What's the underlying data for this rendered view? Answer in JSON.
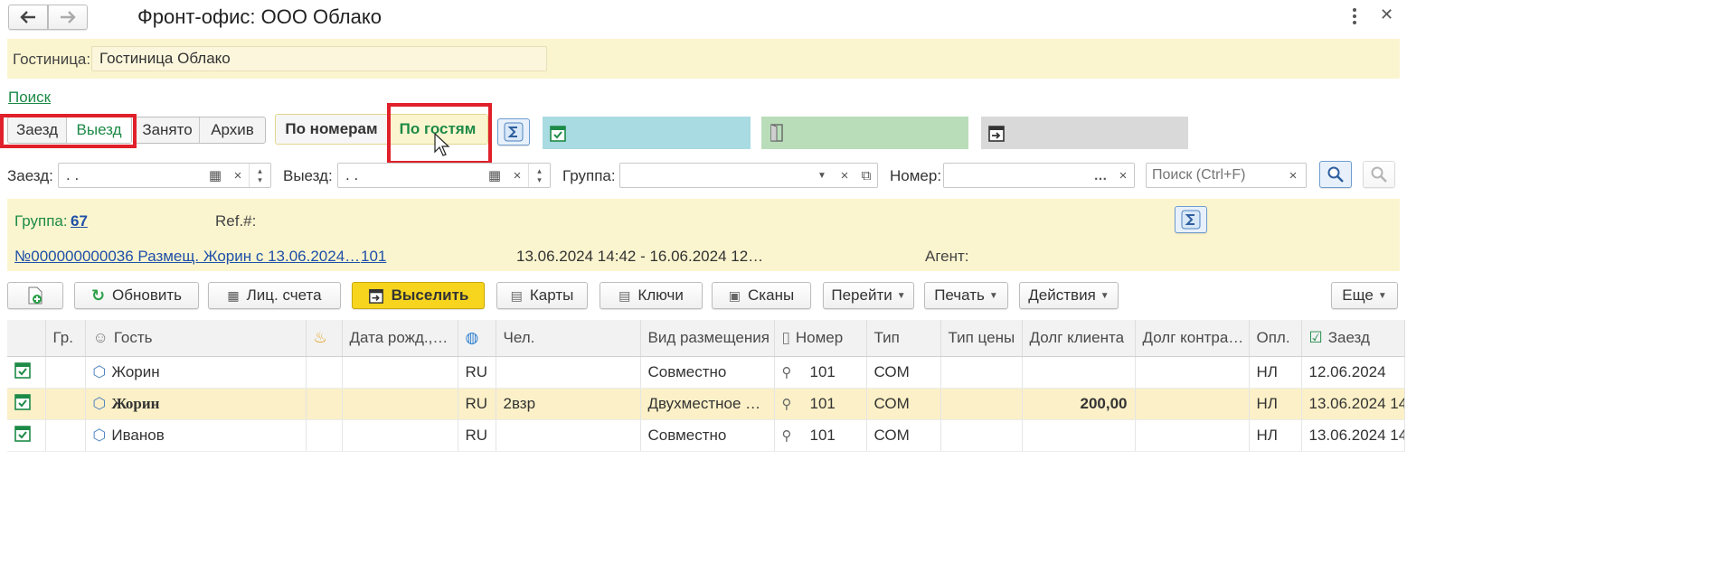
{
  "window": {
    "title": "Фронт-офис: ООО Облако"
  },
  "hotel": {
    "label": "Гостиница:",
    "value": "Гостиница Облако"
  },
  "search_link": "Поиск",
  "status_tabs": [
    "Заезд",
    "Выезд",
    "Занято",
    "Архив"
  ],
  "view_tabs": [
    "По номерам",
    "По гостям"
  ],
  "filters": {
    "checkin_label": "Заезд:",
    "checkin_value": " .  .",
    "checkout_label": "Выезд:",
    "checkout_value": " .  .",
    "group_label": "Группа:",
    "group_value": "",
    "room_label": "Номер:",
    "room_value": "",
    "search_placeholder": "Поиск (Ctrl+F)"
  },
  "info": {
    "group_label": "Группа:",
    "group_value": "67",
    "ref_label": "Ref.#:",
    "doc_link": "№000000000036 Размещ. Жорин с 13.06.2024…",
    "room_link": "101",
    "period": "13.06.2024 14:42 - 16.06.2024 12…",
    "agent_label": "Агент:"
  },
  "toolbar": {
    "refresh": "Обновить",
    "accounts": "Лиц. счета",
    "checkout": "Выселить",
    "cards": "Карты",
    "keys": "Ключи",
    "scans": "Сканы",
    "goto": "Перейти",
    "print": "Печать",
    "actions": "Действия",
    "more": "Еще"
  },
  "table": {
    "headers": [
      "Гр.",
      "Гость",
      "",
      "Дата рожд.,…",
      "",
      "Чел.",
      "Вид размещения",
      "Номер",
      "Тип",
      "Тип цены",
      "Долг клиента",
      "Долг контра…",
      "Опл.",
      "Заезд"
    ],
    "rows": [
      {
        "guest": "Жорин",
        "country": "RU",
        "people": "",
        "accommodation": "Совместно",
        "room": "101",
        "type": "СОМ",
        "price_type": "",
        "client_debt": "",
        "contractor_debt": "",
        "paid": "НЛ",
        "checkin": "12.06.2024"
      },
      {
        "guest": "Жорин",
        "country": "RU",
        "people": "2взр",
        "accommodation": "Двухместное …",
        "room": "101",
        "type": "СОМ",
        "price_type": "",
        "client_debt": "200,00",
        "contractor_debt": "",
        "paid": "НЛ",
        "checkin": "13.06.2024 14"
      },
      {
        "guest": "Иванов",
        "country": "RU",
        "people": "",
        "accommodation": "Совместно",
        "room": "101",
        "type": "СОМ",
        "price_type": "",
        "client_debt": "",
        "contractor_debt": "",
        "paid": "НЛ",
        "checkin": "13.06.2024 14"
      }
    ]
  },
  "colors": {
    "accent_green": "#1d8a47",
    "highlight_red": "#e0202a",
    "panel_yellow": "#fbf5cf",
    "checkout_yellow": "#f7d51f"
  }
}
